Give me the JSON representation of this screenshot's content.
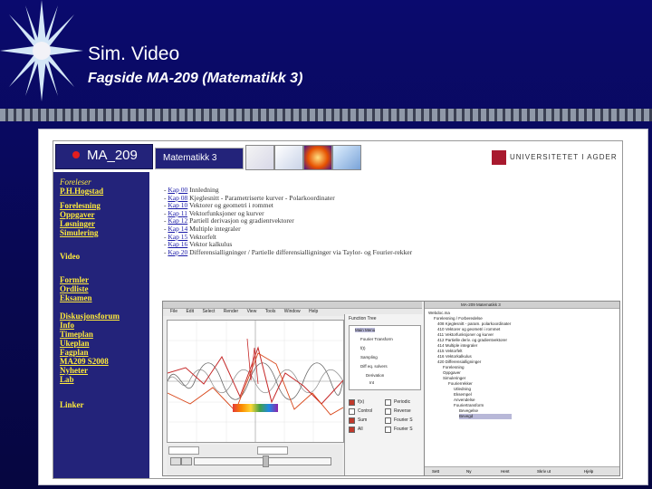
{
  "slide": {
    "title": "Sim. Video",
    "subtitle": "Fagside MA-209 (Matematikk 3)"
  },
  "colors": {
    "background": "#0a0a6e",
    "sidebar": "#23237a",
    "sidebar_link": "#ffeb3b",
    "bullet": "#e21e1e",
    "chapter_link": "#1a1aa8"
  },
  "webpage": {
    "course_code": "MA_209",
    "course_name": "Matematikk 3",
    "university": "UNIVERSITETET I AGDER",
    "sidebar": {
      "lecturer_label": "Foreleser",
      "lecturer_name": "P.H.Hogstad",
      "nav_a": [
        "Forelesning",
        "Oppgaver",
        "Løsninger",
        "Simulering"
      ],
      "video": "Video",
      "nav_b": [
        "Formler",
        "Ordliste",
        "Eksamen"
      ],
      "nav_c": [
        "Diskusjonsforum",
        "Info",
        "Timeplan",
        "Ukeplan",
        "Fagplan",
        "MA209 S2008",
        "Nyheter",
        "Lab"
      ],
      "links": "Linker"
    },
    "chapters": [
      {
        "num": "Kap 00",
        "text": "Innledning"
      },
      {
        "num": "Kap 08",
        "text": "Kjeglesnitt - Parametriserte kurver - Polarkoordinater"
      },
      {
        "num": "Kap 10",
        "text": "Vektorer og geometri i rommet"
      },
      {
        "num": "Kap 11",
        "text": "Vektorfunksjoner og kurver"
      },
      {
        "num": "Kap 12",
        "text": "Partiell derivasjon og gradientvektorer"
      },
      {
        "num": "Kap 14",
        "text": "Multiple integraler"
      },
      {
        "num": "Kap 15",
        "text": "Vektorfelt"
      },
      {
        "num": "Kap 16",
        "text": "Vektor kalkulus"
      },
      {
        "num": "Kap 20",
        "text": "Differensialligninger / Partielle differensialligninger via Taylor- og Fourier-rekker"
      }
    ]
  },
  "app": {
    "menu": [
      "File",
      "Edit",
      "Select",
      "Render",
      "View",
      "Tools",
      "Window",
      "Help"
    ],
    "panel_title": "Function Tree",
    "tree": [
      "Main Menu",
      "Fourier Transform",
      "f(t)",
      "Sampling",
      "Diff eq. solvers",
      "Derivation",
      "Int"
    ],
    "checks": [
      {
        "label": "f(x)",
        "on": true,
        "label2": "Periodic",
        "on2": false
      },
      {
        "label": "Control",
        "on": false,
        "label2": "Reverse",
        "on2": false
      },
      {
        "label": "Sum",
        "on": true,
        "label2": "Fourier S",
        "on2": false
      },
      {
        "label": "All",
        "on": true,
        "label2": "Fourier S",
        "on2": false
      }
    ],
    "right_title": "MA-209 Matematikk 3",
    "right_tree": [
      "Webdoc.ma",
      "Forelesning / Forberedelse",
      "408 Kjeglesnitt - param. polarkoordinater",
      "410 Vektorer og geometri i rommet",
      "411 Vektorfunksjoner og kurver",
      "412 Partielle deriv. og gradientvektorer",
      "414 Multiple integraler",
      "415 Vektorfelt",
      "416 Vektorkalkulus",
      "420 Differensialligninger",
      "Forelesning",
      "Oppgaver",
      "Simuleringer",
      "Fourierrekker",
      "Utledning",
      "Eksempel",
      "Anvendelse",
      "Fouriertransform",
      "Bevegelse",
      "Bevegd"
    ],
    "bottom": [
      "Sett",
      "Ny",
      "Hent",
      "Skriv ut",
      "Hjelp"
    ]
  }
}
